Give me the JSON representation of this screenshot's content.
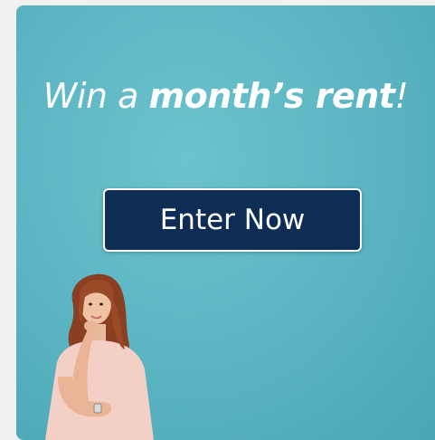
{
  "promo": {
    "headline_part1": "Win a ",
    "headline_part2": "month’s rent",
    "headline_part3": "!",
    "cta_label": "Enter Now"
  },
  "colors": {
    "card_background": "#5db6c3",
    "button_background": "#0d2d55",
    "button_text": "#ffffff",
    "headline_text": "#ffffff"
  }
}
